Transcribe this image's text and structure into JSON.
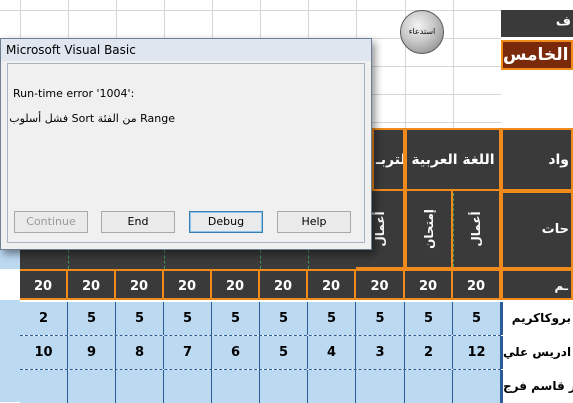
{
  "sheet": {
    "title_top": "ف",
    "title_bottom": "الخامس",
    "recall_button": "استدعاء",
    "headers": {
      "right_top": "واد",
      "arabic_language": "اللغة العربية",
      "partial_subject": "التربـ",
      "right_mid": "حات",
      "sub_exam": "إمتحان",
      "sub_work": "أعمال",
      "sub_work_partial": "أعمال",
      "max_label": "ـم"
    },
    "max_row": [
      "20",
      "20",
      "20",
      "20",
      "20",
      "20",
      "20",
      "20",
      "20",
      "20"
    ],
    "students": [
      {
        "name": "بروكاكريم",
        "scores": [
          "2",
          "5",
          "5",
          "5",
          "5",
          "5",
          "5",
          "5",
          "5",
          "5"
        ]
      },
      {
        "name": "ادريس علي",
        "scores": [
          "10",
          "9",
          "8",
          "7",
          "6",
          "5",
          "4",
          "3",
          "2",
          "12"
        ]
      },
      {
        "name": "تار قاسم فرج",
        "scores": [
          "",
          "",
          "",
          "",
          "",
          "",
          "",
          "",
          "",
          ""
        ]
      }
    ]
  },
  "dialog": {
    "title": "Microsoft Visual Basic",
    "error": "Run-time error '1004':",
    "message": "Range من الفئة  Sort فشل أسلوب",
    "buttons": {
      "continue": "Continue",
      "end": "End",
      "debug": "Debug",
      "help": "Help"
    }
  }
}
